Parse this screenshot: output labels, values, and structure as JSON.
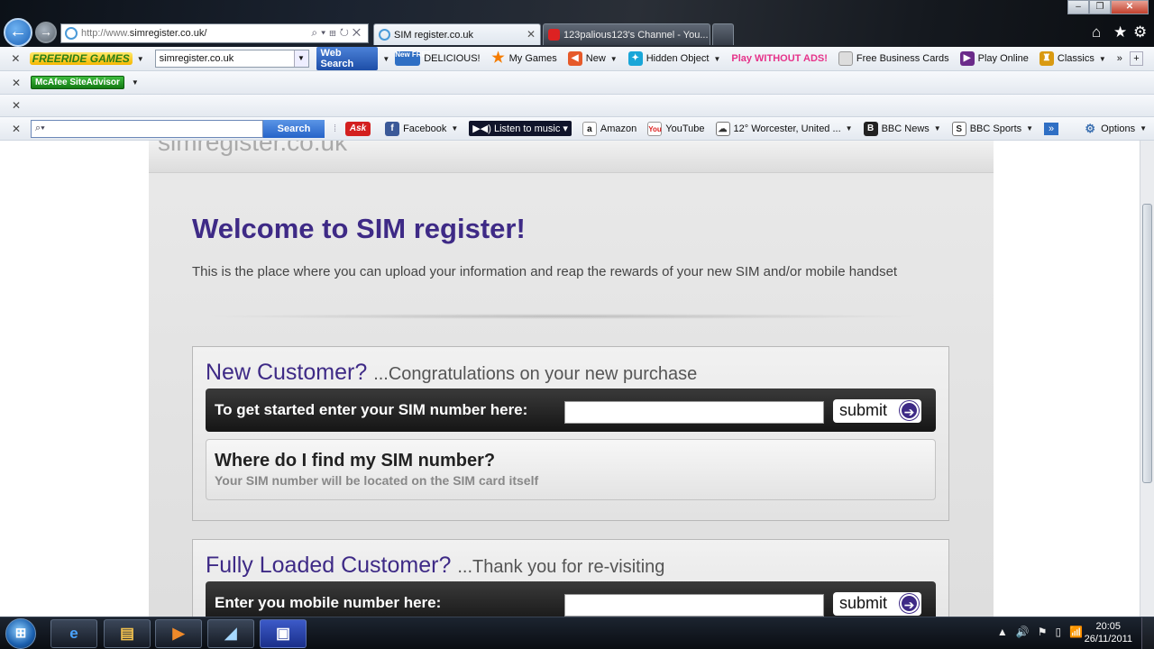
{
  "browser": {
    "address_url_prefix": "http://www.",
    "address_url_domain": "simregister.co.uk/",
    "tabs": [
      {
        "label": "SIM register.co.uk",
        "active": true
      },
      {
        "label": "123palious123's Channel - You...",
        "active": false
      }
    ]
  },
  "toolbar1": {
    "freeride_label": "FREERIDE GAMES",
    "search_combo_value": "simregister.co.uk",
    "web_search_label": "Web Search",
    "new_free_badge": "New FREE",
    "delicious_label": "DELICIOUS!",
    "my_games_label": "My Games",
    "new_label": "New",
    "hidden_object_label": "Hidden Object",
    "play_without_ads_label": "Play WITHOUT ADS!",
    "free_business_cards_label": "Free Business Cards",
    "play_online_label": "Play Online",
    "classics_label": "Classics"
  },
  "toolbar2": {
    "mcafee_label": "McAfee SiteAdvisor"
  },
  "toolbar4": {
    "search_button_label": "Search",
    "ask_label": "Ask",
    "facebook_label": "Facebook",
    "listen_label": "Listen to music",
    "amazon_label": "Amazon",
    "youtube_label": "YouTube",
    "weather_label": "12° Worcester, United ...",
    "bbc_news_label": "BBC News",
    "bbc_sports_label": "BBC Sports",
    "options_label": "Options"
  },
  "page": {
    "welcome_title": "Welcome to SIM register!",
    "intro_text": "This is the place where you can upload your information and reap the rewards of your new SIM and/or mobile handset",
    "new_customer": {
      "title": "New Customer?",
      "subtitle": "...Congratulations on your new purchase",
      "field_label": "To get started enter your SIM number here:",
      "sim_value": "",
      "submit_label": "submit",
      "help_title": "Where do I find my SIM number?",
      "help_text": "Your SIM number will be located on the SIM card itself"
    },
    "loaded_customer": {
      "title": "Fully Loaded Customer?",
      "subtitle": "...Thank you for re-visiting",
      "field_label": "Enter you mobile number here:",
      "mobile_value": "",
      "submit_label": "submit"
    }
  },
  "taskbar": {
    "time": "20:05",
    "date": "26/11/2011"
  },
  "colors": {
    "brand_purple": "#3e2a86",
    "form_bar": "#1e1e1e",
    "page_bg": "#e4e4e4"
  }
}
